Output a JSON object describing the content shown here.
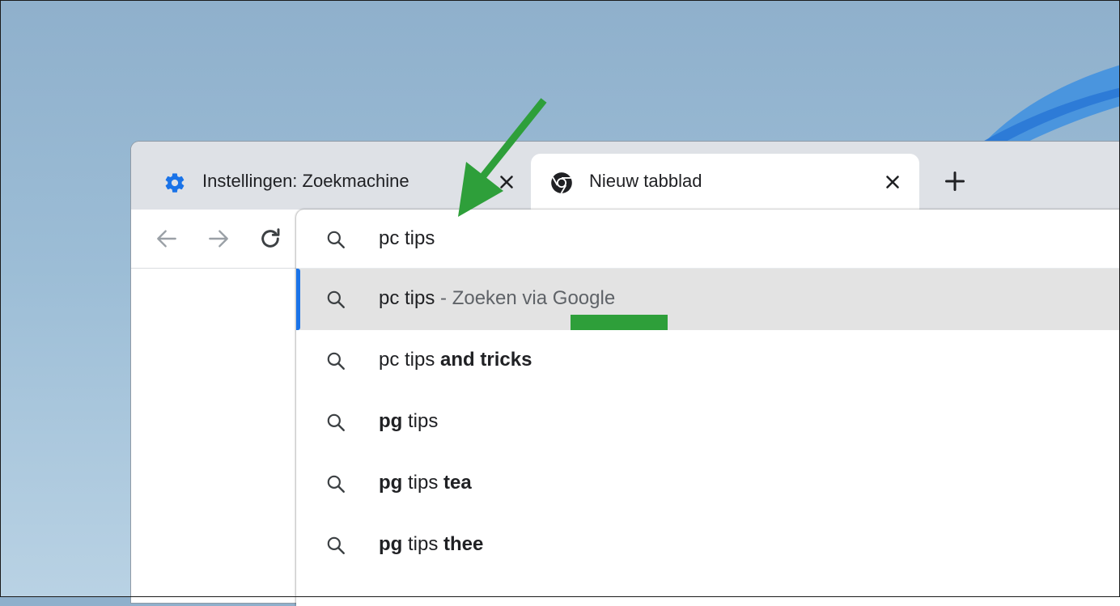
{
  "browser": {
    "tabs": [
      {
        "label": "Instellingen: Zoekmachine",
        "icon": "gear-icon",
        "active": false
      },
      {
        "label": "Nieuw tabblad",
        "icon": "chrome-icon",
        "active": true
      }
    ],
    "new_tab_icon": "plus-icon"
  },
  "toolbar": {
    "back_icon": "arrow-left-icon",
    "forward_icon": "arrow-right-icon",
    "reload_icon": "reload-icon"
  },
  "omnibox": {
    "query": "pc tips",
    "search_icon": "search-icon",
    "suggestions": [
      {
        "plain": "pc tips",
        "suffix": " - Zoeken via Google",
        "selected": true
      },
      {
        "plain": "pc tips ",
        "bold": "and tricks"
      },
      {
        "bold": "pg",
        "plain": " tips"
      },
      {
        "bold": "pg",
        "plain": " tips ",
        "bold2": "tea"
      },
      {
        "bold": "pg",
        "plain": " tips ",
        "bold2": "thee"
      }
    ]
  },
  "annotation": {
    "arrow_color": "#2e9f3a",
    "underline_color": "#2e9f3a"
  },
  "colors": {
    "accent": "#1a73e8",
    "gear": "#1a73e8",
    "tabstrip": "#dee1e6",
    "selected_row": "#e3e3e3"
  }
}
